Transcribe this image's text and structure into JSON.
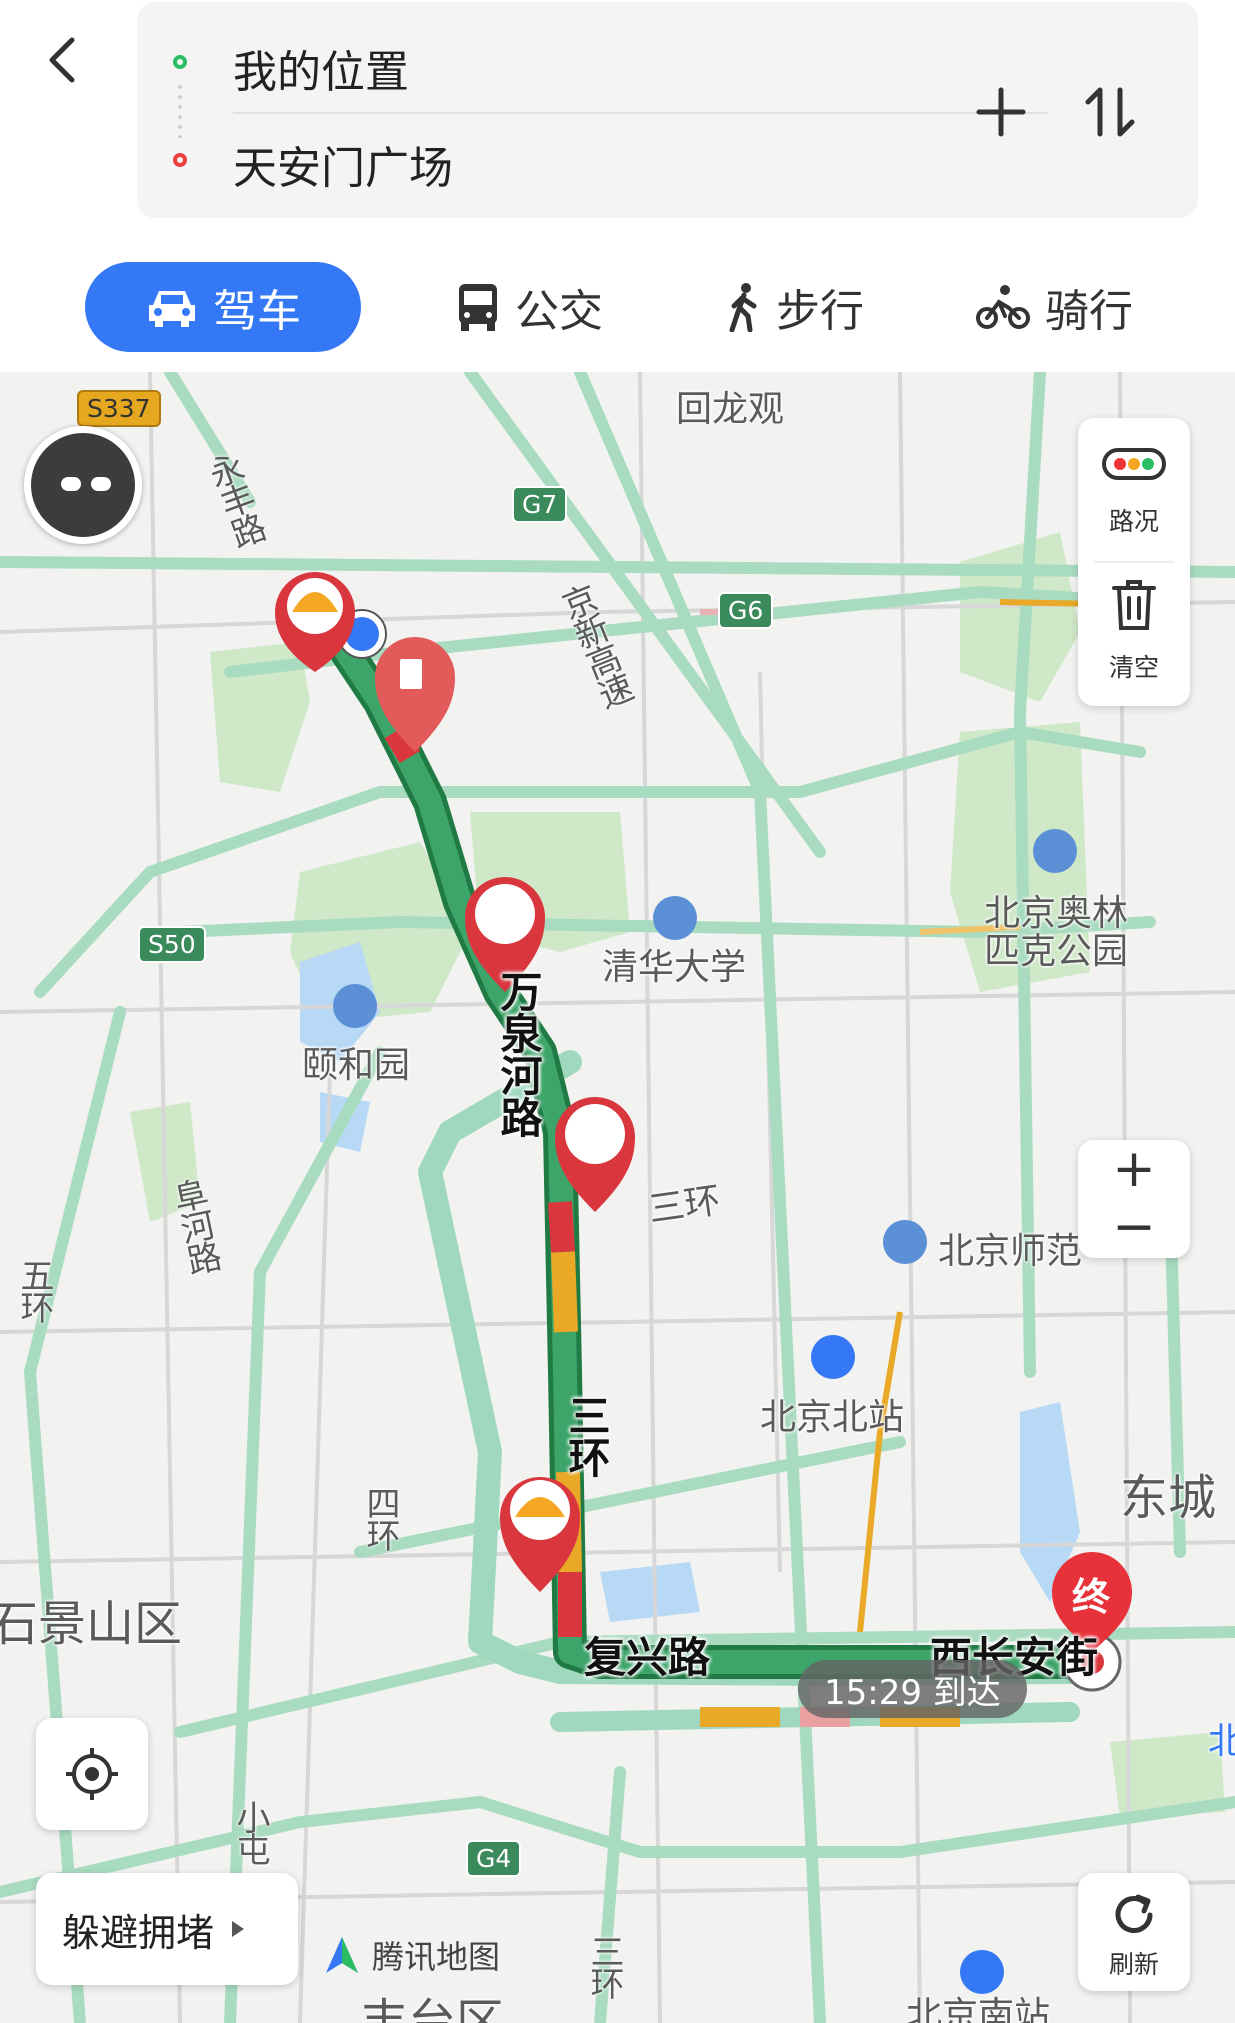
{
  "header": {
    "from": "我的位置",
    "to": "天安门广场",
    "modes": [
      {
        "label": "驾车"
      },
      {
        "label": "公交"
      },
      {
        "label": "步行"
      },
      {
        "label": "骑行"
      }
    ]
  },
  "map": {
    "labels": {
      "huilongguan": "回龙观",
      "tsinghua": "清华大学",
      "olympic_line1": "北京奥林",
      "olympic_line2": "匹克公园",
      "summer_palace": "颐和园",
      "bnu": "北京师范",
      "bj_north": "北京北站",
      "dongcheng": "东城",
      "shijingshan": "石景山区",
      "fengtai": "丰台区",
      "bj_south": "北京南站",
      "yongfeng": "永丰路",
      "jingxin": "京新高速",
      "fuhe": "阜河路",
      "wuhuan": "五环",
      "sihuan": "四环",
      "xiaotun": "小屯",
      "sanhuan_low": "三环",
      "sanhuan_right": "三环",
      "bei": "北"
    },
    "route_names": {
      "wanquanhe": "万泉河路",
      "sanhuan": "三环",
      "fuxing": "复兴路",
      "xichangan": "西长安街"
    },
    "shields": {
      "s337": "S337",
      "g7": "G7",
      "g6": "G6",
      "s50": "S50",
      "g4": "G4"
    },
    "controls": {
      "traffic": "路况",
      "clear": "清空",
      "avoid": "躲避拥堵",
      "refresh": "刷新",
      "zoom_in": "+",
      "zoom_out": "−"
    },
    "destination_marker": "终",
    "eta": "15:29 到达",
    "brand": "腾讯地图"
  },
  "colors": {
    "accent": "#3478f6",
    "route_green": "#2f9e57",
    "route_alt": "#9fd8bf",
    "congestion_red": "#d9363e",
    "slow_yellow": "#e9a826"
  }
}
